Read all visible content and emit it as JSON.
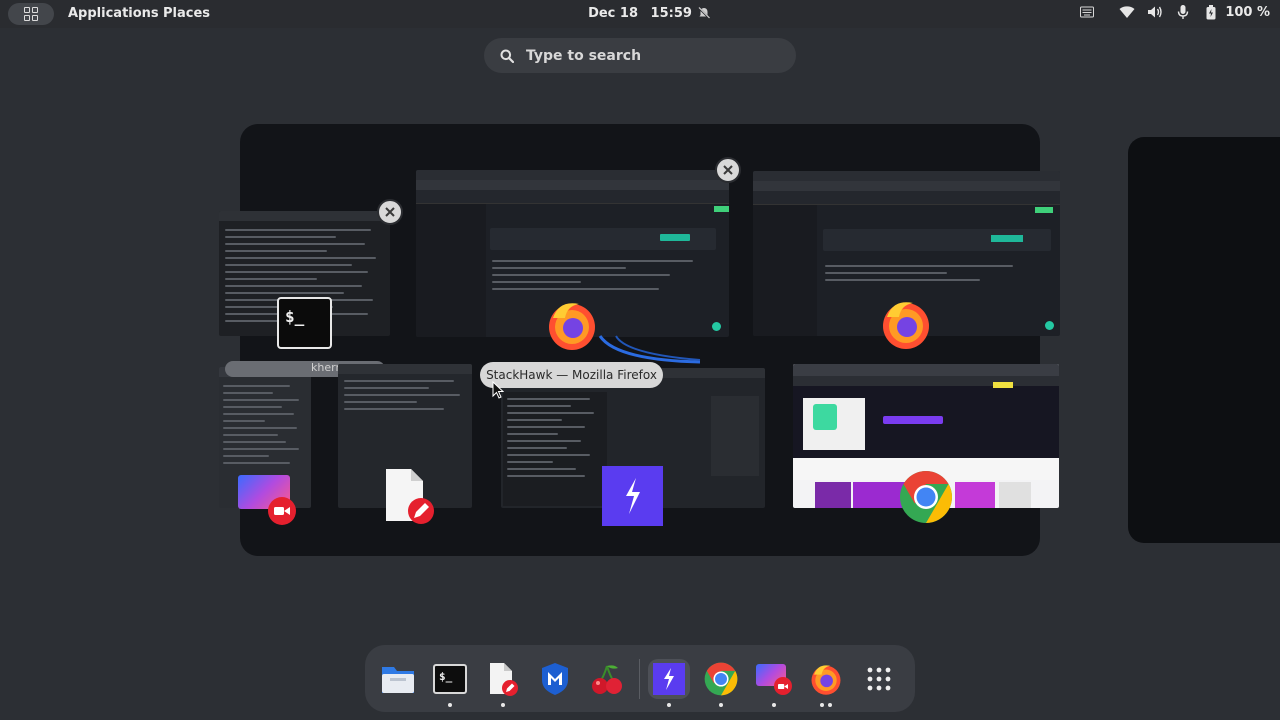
{
  "topbar": {
    "applications_label": "Applications",
    "places_label": "Places",
    "date": "Dec 18",
    "time": "15:59",
    "battery_percent": "100 %"
  },
  "search": {
    "placeholder": "Type to search"
  },
  "windows": {
    "terminal_label": "Terminal",
    "firefox_label": "StackHawk — Mozilla Firefox",
    "partial_label_fragment": "kherr"
  },
  "dock": {
    "items": [
      {
        "name": "Files",
        "icon": "file-manager-icon"
      },
      {
        "name": "Terminal",
        "icon": "terminal-icon"
      },
      {
        "name": "Text Editor",
        "icon": "text-editor-icon"
      },
      {
        "name": "Metasploit",
        "icon": "metasploit-icon"
      },
      {
        "name": "Cherrytree",
        "icon": "cherry-icon"
      },
      {
        "name": "StackHawk",
        "icon": "stackhawk-icon"
      },
      {
        "name": "Google Chrome",
        "icon": "chrome-icon"
      },
      {
        "name": "Screen Recorder",
        "icon": "recorder-icon"
      },
      {
        "name": "Firefox",
        "icon": "firefox-icon"
      },
      {
        "name": "Show Applications",
        "icon": "app-grid-icon"
      }
    ]
  },
  "colors": {
    "stackhawk_accent": "#5a3cf0",
    "firefox_orange": "#ff6a1a",
    "chrome_red": "#ea4335",
    "recorder_red": "#e5202e"
  }
}
